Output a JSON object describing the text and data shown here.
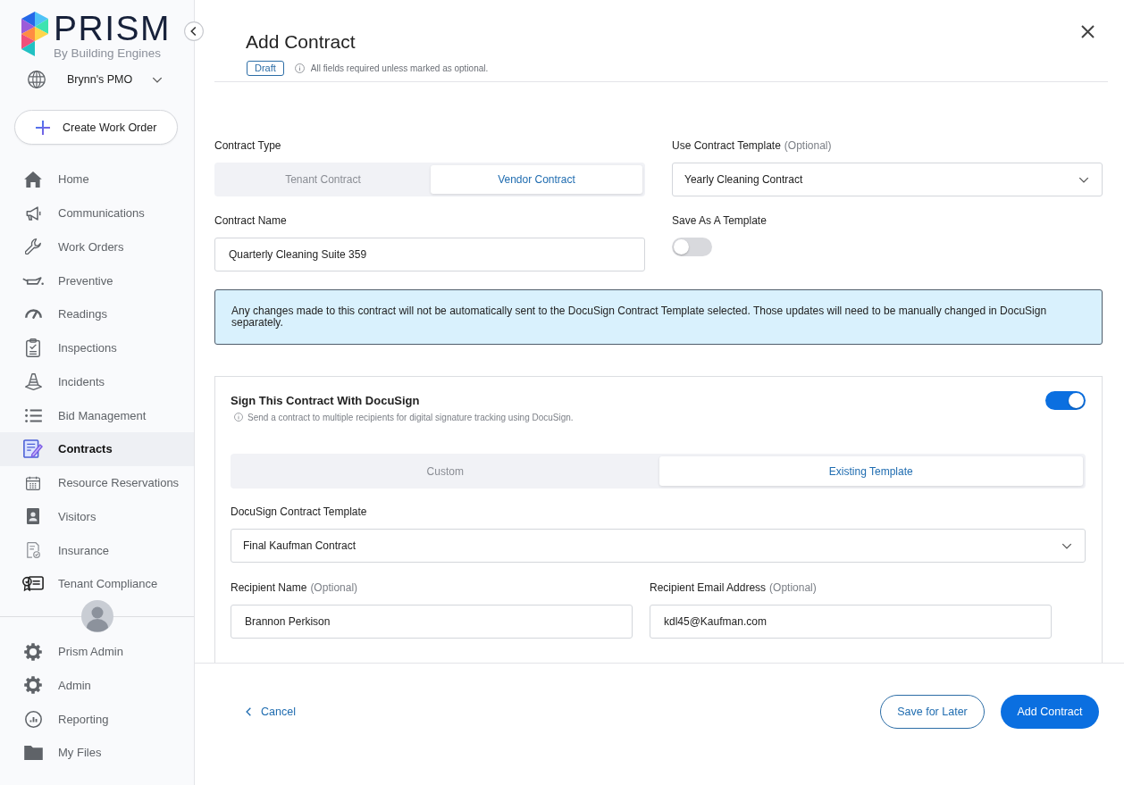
{
  "sidebar": {
    "logo": {
      "wordmark": "PRISM",
      "tagline": "By Building Engines"
    },
    "account": {
      "name": "Brynn's PMO"
    },
    "create_button": {
      "label": "Create Work Order"
    },
    "nav_items": [
      {
        "label": "Home",
        "selected": false
      },
      {
        "label": "Communications",
        "selected": false
      },
      {
        "label": "Work Orders",
        "selected": false
      },
      {
        "label": "Preventive",
        "selected": false
      },
      {
        "label": "Readings",
        "selected": false
      },
      {
        "label": "Inspections",
        "selected": false
      },
      {
        "label": "Incidents",
        "selected": false
      },
      {
        "label": "Bid Management",
        "selected": false
      },
      {
        "label": "Contracts",
        "selected": true
      },
      {
        "label": "Resource Reservations",
        "selected": false
      },
      {
        "label": "Visitors",
        "selected": false
      },
      {
        "label": "Insurance",
        "selected": false
      },
      {
        "label": "Tenant Compliance",
        "selected": false
      }
    ],
    "admin_items": [
      {
        "label": "Prism Admin",
        "selected": false
      },
      {
        "label": "Admin",
        "selected": false
      },
      {
        "label": "Reporting",
        "selected": false
      },
      {
        "label": "My Files",
        "selected": false
      }
    ]
  },
  "dialog": {
    "title": "Add Contract",
    "status_badge": "Draft",
    "note": "All fields required unless marked as optional.",
    "form": {
      "contract_type": {
        "label": "Contract Type",
        "options": [
          {
            "label": "Tenant Contract",
            "selected": false
          },
          {
            "label": "Vendor Contract",
            "selected": true
          }
        ]
      },
      "contract_template": {
        "label": "Use Contract Template",
        "optional": "(Optional)",
        "value": "Yearly Cleaning Contract"
      },
      "contract_name": {
        "label": "Contract Name",
        "value": "Quarterly Cleaning Suite 359"
      },
      "save_as_template": {
        "label": "Save As A Template",
        "on": false
      },
      "notice": "Any changes made to this contract will not be automatically sent to the DocuSign Contract Template selected. Those updates will need to be manually changed in DocuSign separately.",
      "docusign": {
        "title": "Sign This Contract With DocuSign",
        "description": "Send a contract to multiple recipients for digital signature tracking using DocuSign.",
        "on": true,
        "modes": [
          {
            "label": "Custom",
            "selected": false
          },
          {
            "label": "Existing Template",
            "selected": true
          }
        ],
        "template": {
          "label": "DocuSign Contract Template",
          "value": "Final Kaufman Contract"
        },
        "recipients": [
          {
            "name_label": "Recipient Name",
            "name_optional": "(Optional)",
            "name": "Brannon Perkison",
            "email_label": "Recipient Email Address",
            "email_optional": "(Optional)",
            "email": "kdl45@Kaufman.com"
          }
        ]
      }
    },
    "footer": {
      "cancel": "Cancel",
      "secondary_button": "Save for Later",
      "primary_button": "Add Contract"
    }
  }
}
